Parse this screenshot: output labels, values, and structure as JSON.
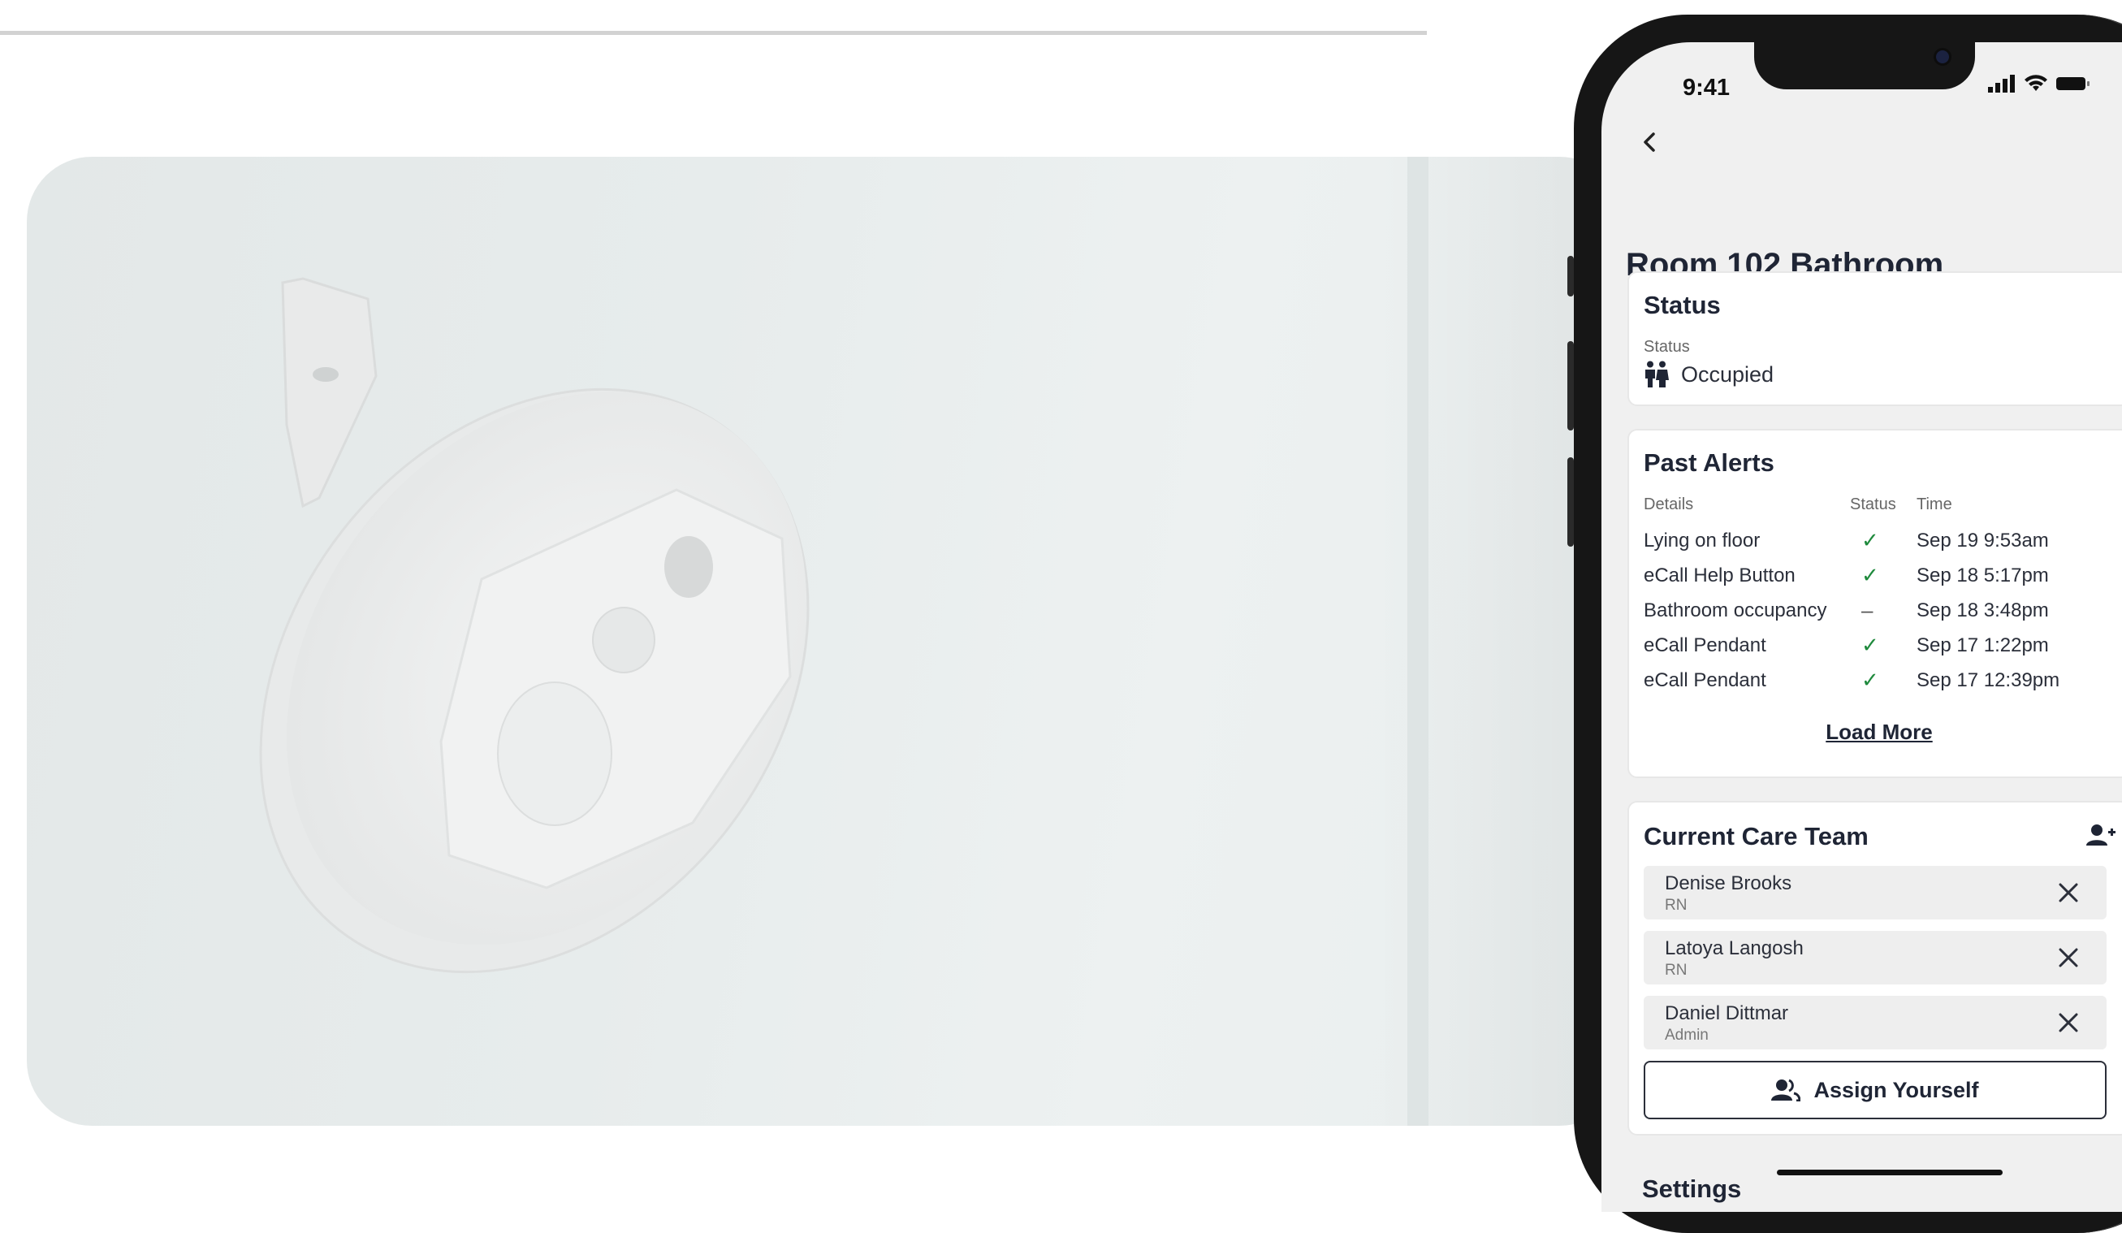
{
  "phone": {
    "time": "9:41",
    "back_icon": "chevron-left-icon",
    "page_title": "Room 102 Bathroom",
    "status_card": {
      "title": "Status",
      "label": "Status",
      "value": "Occupied",
      "icon": "people-icon"
    },
    "past_alerts": {
      "title": "Past Alerts",
      "columns": [
        "Details",
        "Status",
        "Time"
      ],
      "rows": [
        {
          "details": "Lying on floor",
          "status": "check",
          "time": "Sep 19 9:53am"
        },
        {
          "details": "eCall Help Button",
          "status": "check",
          "time": "Sep 18 5:17pm"
        },
        {
          "details": "Bathroom occupancy",
          "status": "dash",
          "time": "Sep 18 3:48pm"
        },
        {
          "details": "eCall Pendant",
          "status": "check",
          "time": "Sep 17 1:22pm"
        },
        {
          "details": "eCall Pendant",
          "status": "check",
          "time": "Sep 17 12:39pm"
        }
      ],
      "load_more": "Load More"
    },
    "care_team": {
      "title": "Current Care Team",
      "add_icon": "add-person-icon",
      "members": [
        {
          "name": "Denise Brooks",
          "role": "RN"
        },
        {
          "name": "Latoya Langosh",
          "role": "RN"
        },
        {
          "name": "Daniel Dittmar",
          "role": "Admin"
        }
      ],
      "assign_button": "Assign Yourself"
    },
    "next_section": "Settings"
  },
  "colors": {
    "accent": "#1f2535",
    "check": "#1f8a3d",
    "screen_bg": "#f0f0f0"
  }
}
